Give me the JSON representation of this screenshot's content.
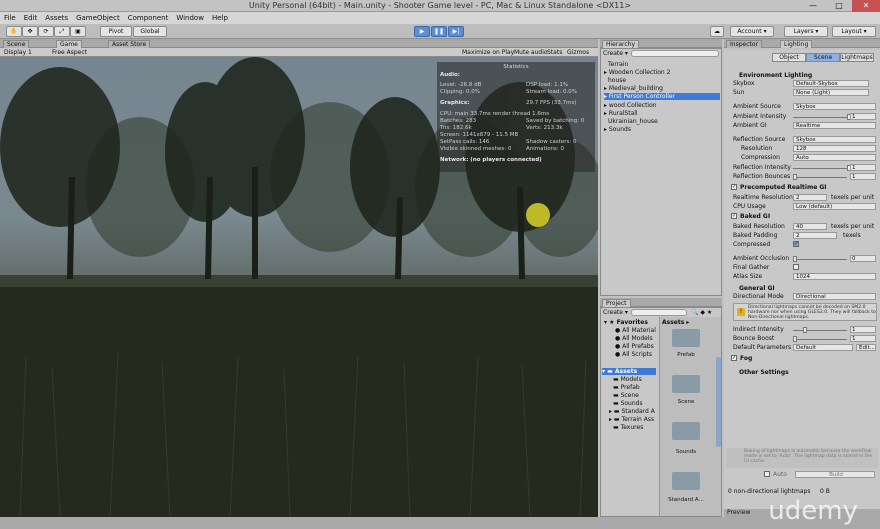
{
  "window": {
    "title": "Unity Personal (64bit) - Main.unity - Shooter Game level - PC, Mac & Linux Standalone <DX11>",
    "min": "—",
    "max": "□",
    "close": "✕"
  },
  "menu": [
    "File",
    "Edit",
    "Assets",
    "GameObject",
    "Component",
    "Window",
    "Help"
  ],
  "toolbar": {
    "pivot": "Pivot",
    "global": "Global",
    "account": "Account",
    "layers": "Layers",
    "layout": "Layout"
  },
  "tabs": {
    "scene": "Scene",
    "game": "Game",
    "asset_store": "Asset Store",
    "hierarchy": "Hierarchy",
    "inspector": "Inspector",
    "lighting": "Lighting",
    "project": "Project"
  },
  "game_bar": {
    "display": "Display 1",
    "aspect": "Free Aspect",
    "maximize": "Maximize on Play",
    "mute": "Mute audio",
    "stats": "Stats",
    "gizmos": "Gizmos"
  },
  "stats": {
    "title": "Statistics",
    "audio": "Audio:",
    "level": "Level: -26.8 dB",
    "dsp": "DSP load: 1.1%",
    "clipping": "Clipping: 0.0%",
    "stream": "Stream load: 0.0%",
    "graphics": "Graphics:",
    "fps": "29.7 FPS (33.7ms)",
    "cpu": "CPU: main 33.7ms  render thread 1.6ms",
    "batches": "Batches: 283",
    "saved": "Saved by batching: 0",
    "tris": "Tris: 182.6k",
    "verts": "Verts: 213.3k",
    "screen": "Screen: 1141x879 - 11.5 MB",
    "setpass": "SetPass calls: 146",
    "shadow": "Shadow casters: 0",
    "skinned": "Visible skinned meshes: 0",
    "anims": "Animations: 0",
    "network": "Network: (no players connected)"
  },
  "hierarchy": {
    "create": "Create ▾",
    "items": [
      "Terrain",
      "▸ Wooden Collection 2",
      "house",
      "▸ Medieval_building",
      "▸ First Person Controller",
      "▸ wood Collection",
      "▸ RuralStall",
      "Ukrainian_house",
      "▸ Sounds"
    ]
  },
  "project": {
    "create": "Create ▾",
    "favorites": "Favorites",
    "fav_items": [
      "All Material",
      "All Models",
      "All Prefabs",
      "All Scripts"
    ],
    "assets": "Assets",
    "asset_tree": [
      "Models",
      "Prefab",
      "Scene",
      "Sounds",
      "Standard A",
      "Terrain Ass",
      "Texures"
    ],
    "grid_header": "Assets ▸",
    "grid_items": [
      "Prefab",
      "Scene",
      "Sounds",
      "Standard A..."
    ]
  },
  "lighting": {
    "subtabs": [
      "Object",
      "Scene",
      "Lightmaps"
    ],
    "env_title": "Environment Lighting",
    "skybox": "Skybox",
    "skybox_val": "Default-Skybox",
    "sun": "Sun",
    "sun_val": "None (Light)",
    "amb_source": "Ambient Source",
    "amb_source_val": "Skybox",
    "amb_intensity": "Ambient Intensity",
    "amb_intensity_val": "1",
    "amb_gi": "Ambient GI",
    "amb_gi_val": "Realtime",
    "refl_source": "Reflection Source",
    "refl_source_val": "Skybox",
    "resolution": "Resolution",
    "resolution_val": "128",
    "compression": "Compression",
    "compression_val": "Auto",
    "refl_intensity": "Reflection Intensity",
    "refl_intensity_val": "1",
    "refl_bounces": "Reflection Bounces",
    "refl_bounces_val": "1",
    "precomp_title": "Precomputed Realtime GI",
    "rt_res": "Realtime Resolution",
    "rt_res_val": "2",
    "rt_res_unit": "texels per unit",
    "cpu_usage": "CPU Usage",
    "cpu_usage_val": "Low (default)",
    "baked_title": "Baked GI",
    "baked_res": "Baked Resolution",
    "baked_res_val": "40",
    "baked_res_unit": "texels per unit",
    "baked_pad": "Baked Padding",
    "baked_pad_val": "2",
    "baked_pad_unit": "texels",
    "compressed": "Compressed",
    "amb_occ": "Ambient Occlusion",
    "amb_occ_val": "0",
    "final_gather": "Final Gather",
    "atlas": "Atlas Size",
    "atlas_val": "1024",
    "general_title": "General GI",
    "dir_mode": "Directional Mode",
    "dir_mode_val": "Directional",
    "warn": "Directional lightmaps cannot be decoded on SM2.0 hardware nor when using GLES2.0. They will fallback to Non-Directional lightmaps.",
    "indirect": "Indirect Intensity",
    "indirect_val": "1",
    "bounce": "Bounce Boost",
    "bounce_val": "1",
    "default_params": "Default Parameters",
    "default_params_val": "Default",
    "edit": "Edit...",
    "fog": "Fog",
    "other": "Other Settings",
    "auto": "Auto",
    "build": "Build",
    "baking_note": "Baking of lightmaps is automatic because the workflow mode is set to 'Auto'. The lightmap data is stored in the GI cache.",
    "nondir": "0 non-directional lightmaps",
    "nondir_val": "0 B",
    "preview": "Preview"
  },
  "watermark": "udemy"
}
